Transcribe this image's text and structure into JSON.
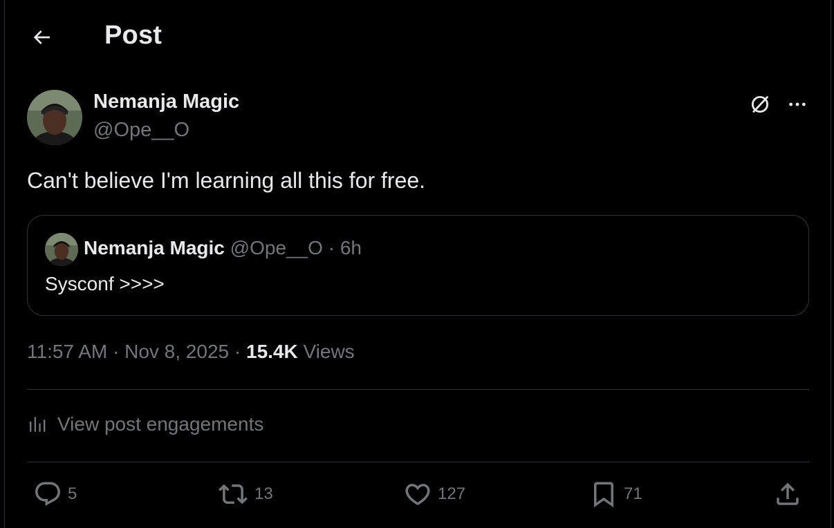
{
  "header": {
    "title": "Post",
    "back_icon": "arrow-left-icon"
  },
  "post": {
    "author_name": "Nemanja Magic",
    "author_handle": "@Ope__O",
    "text": "Can't believe I'm learning all this for free.",
    "timestamp": "11:57 AM · Nov 8, 2025",
    "separator": " · ",
    "views_count": "15.4K",
    "views_label": " Views"
  },
  "quote": {
    "author_name": "Nemanja Magic",
    "author_handle": "@Ope__O",
    "separator": " · ",
    "time": "6h",
    "text": "Sysconf >>>>"
  },
  "engagements": {
    "label": "View post engagements"
  },
  "actions": {
    "replies": "5",
    "reposts": "13",
    "likes": "127",
    "bookmarks": "71"
  },
  "colors": {
    "background": "#000000",
    "text_primary": "#e7e9ea",
    "text_secondary": "#71767b",
    "border": "#2f3336"
  }
}
